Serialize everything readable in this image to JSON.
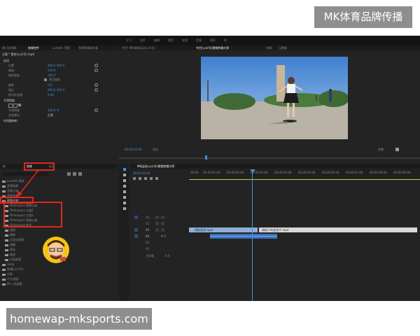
{
  "overlay": {
    "brand_label": "MK体育品牌传播",
    "site_url": "homewap-mksports.com"
  },
  "top_nav": {
    "items": [
      "学习",
      "组件",
      "编辑",
      "颜色",
      "效果",
      "音频",
      "图形",
      "库"
    ]
  },
  "effect_controls": {
    "tabs": [
      "效果控件",
      "Lumetri 范围",
      "源:(无剪辑)",
      "音频剪辑混合器"
    ],
    "clip_path": "主要 * 素材(公众号).mp4",
    "section_motion": "运动",
    "props": [
      {
        "label": "位置",
        "value": "960.0    540.0"
      },
      {
        "label": "缩放",
        "value": "100.0"
      },
      {
        "label": "缩放宽度",
        "value": "100.0"
      },
      {
        "label": "等比缩放",
        "value": ""
      },
      {
        "label": "旋转",
        "value": "0.0"
      },
      {
        "label": "锚点",
        "value": "960.0    540.0"
      },
      {
        "label": "防闪烁滤镜",
        "value": "0.00"
      },
      {
        "label": "不透明度",
        "value": ""
      },
      {
        "label": "不透明度",
        "value": "100.0 %"
      },
      {
        "label": "混合模式",
        "value": "正常"
      },
      {
        "label": "时间重映射",
        "value": ""
      }
    ],
    "timecode": "00:00:03:06"
  },
  "program_monitor": {
    "tabs": [
      "节目: MK体育运动(公众号)",
      "节目(公众号)视频剪辑大师",
      "字幕",
      "元数据"
    ],
    "timecode": "00:00:03:06",
    "fit": "适合",
    "quality": "完整"
  },
  "effects_panel": {
    "tabs": [
      "库",
      "效果",
      "标记"
    ],
    "tree": [
      "Lumetri 预设",
      "音频效果",
      "音频过渡",
      "视频效果",
      "视频过渡",
      "Filmimpact 视频过渡",
      "Filmimpact 过渡2",
      "Filmimpact 过渡3",
      "Filmimpact 视频过渡",
      "Filmimpact 转场",
      "变换",
      "擦除",
      "沉浸式视频",
      "溶解",
      "滑动",
      "缩放",
      "页面剥落",
      "Unity",
      "剪辑(公众号)",
      "位移",
      "片头滤镜",
      "IN 入场滤镜"
    ]
  },
  "timeline": {
    "sequence_tab": "MK运动(公众号)视频剪辑大师",
    "timecode": "00:00:03:06",
    "ruler": [
      "00:00",
      "00:00:01:00",
      "00:00:02:00",
      "00:00:03:00",
      "00:00:04:00",
      "00:00:05:00",
      "00:00:06:00",
      "00:00:07:00",
      "00:00:08:00",
      "00:00:09:00"
    ],
    "tracks": [
      {
        "name": "V3"
      },
      {
        "name": "V2"
      },
      {
        "name": "V1"
      },
      {
        "name": "A1"
      },
      {
        "name": "A2"
      },
      {
        "name": "A3"
      }
    ],
    "master_label": "主声道",
    "master_value": "0.0",
    "clips": [
      "滑板女孩.mp4",
      "滑板少年女孩子.mp4"
    ]
  },
  "colors": {
    "panel_bg": "#232323",
    "highlight": "#e0261e",
    "accent": "#4c8fd9",
    "video_clip": "#8fb0d6",
    "audio_clip": "#3b6fbf"
  }
}
